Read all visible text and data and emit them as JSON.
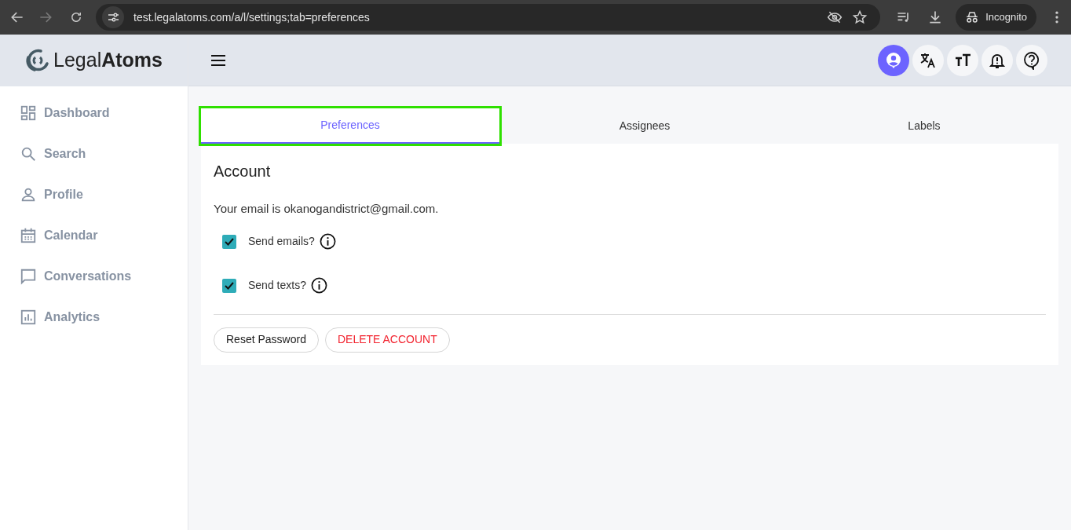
{
  "browser": {
    "url": "test.legalatoms.com/a/l/settings;tab=preferences",
    "profile": "Incognito"
  },
  "logo": {
    "light": "Legal",
    "bold": "Atoms"
  },
  "header": {
    "buttons": [
      {
        "kind": "account",
        "selected": true
      },
      {
        "kind": "translate",
        "selected": false
      },
      {
        "kind": "text-size",
        "selected": false
      },
      {
        "kind": "notifications",
        "selected": false
      },
      {
        "kind": "help",
        "selected": false
      }
    ]
  },
  "sidebar": {
    "items": [
      {
        "label": "Dashboard",
        "kind": "dashboard"
      },
      {
        "label": "Search",
        "kind": "search"
      },
      {
        "label": "Profile",
        "kind": "profile"
      },
      {
        "label": "Calendar",
        "kind": "calendar"
      },
      {
        "label": "Conversations",
        "kind": "conversations"
      },
      {
        "label": "Analytics",
        "kind": "analytics"
      }
    ]
  },
  "tabs": [
    {
      "label": "Preferences",
      "selected": true,
      "highlighted": true
    },
    {
      "label": "Assignees",
      "selected": false,
      "highlighted": false
    },
    {
      "label": "Labels",
      "selected": false,
      "highlighted": false
    }
  ],
  "account": {
    "title": "Account",
    "email_text": "Your email is okanogandistrict@gmail.com.",
    "options": [
      {
        "label": "Send emails?",
        "checked": true
      },
      {
        "label": "Send texts?",
        "checked": true
      }
    ],
    "buttons": [
      {
        "label": "Reset Password",
        "kind": "default"
      },
      {
        "label": "DELETE ACCOUNT",
        "kind": "danger"
      }
    ]
  }
}
